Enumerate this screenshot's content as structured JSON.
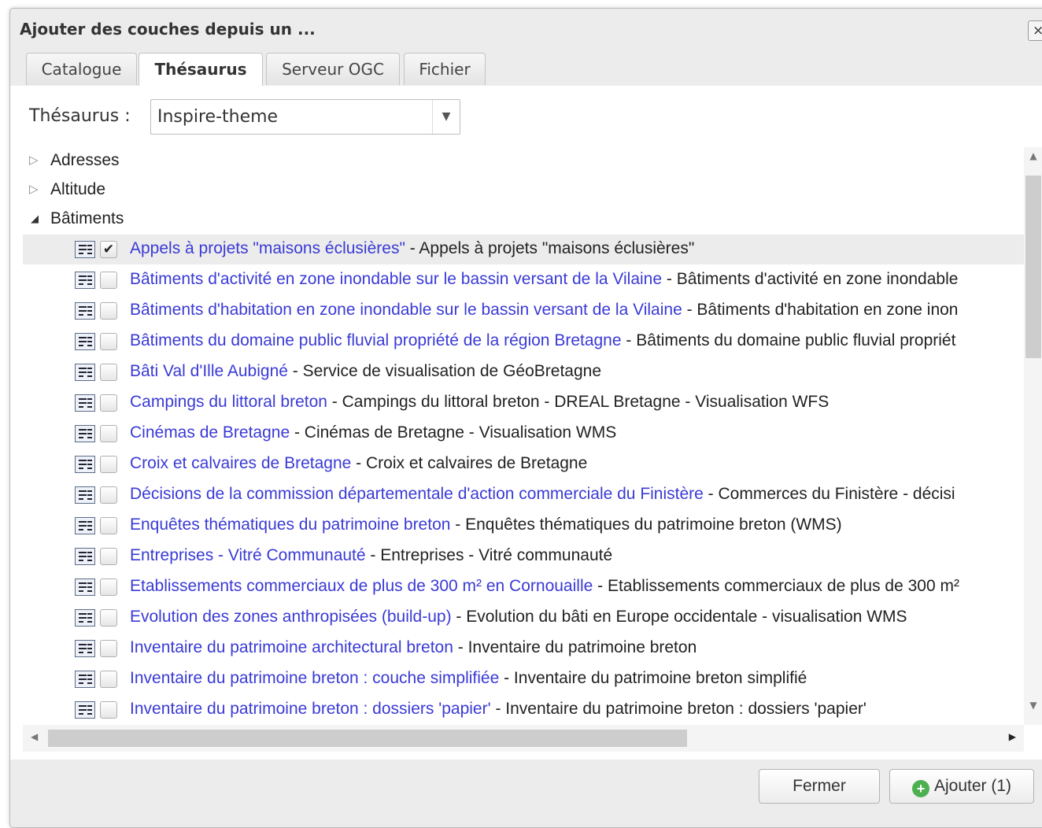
{
  "dialog": {
    "title": "Ajouter des couches depuis un ...",
    "close_label": "×"
  },
  "tabs": [
    {
      "label": "Catalogue"
    },
    {
      "label": "Thésaurus"
    },
    {
      "label": "Serveur OGC"
    },
    {
      "label": "Fichier"
    }
  ],
  "active_tab": "Thésaurus",
  "thesaurus": {
    "label": "Thésaurus :",
    "selected": "Inspire-theme"
  },
  "tree": {
    "nodes": [
      {
        "label": "Adresses",
        "expanded": false
      },
      {
        "label": "Altitude",
        "expanded": false
      },
      {
        "label": "Bâtiments",
        "expanded": true
      }
    ],
    "items": [
      {
        "title": "Appels à projets \"maisons éclusières\"",
        "desc": " - Appels à projets \"maisons éclusières\"",
        "checked": true
      },
      {
        "title": "Bâtiments d'activité en zone inondable sur le bassin versant de la Vilaine",
        "desc": " - Bâtiments d'activité en zone inondable",
        "checked": false
      },
      {
        "title": "Bâtiments d'habitation en zone inondable sur le bassin versant de la Vilaine",
        "desc": " - Bâtiments d'habitation en zone inon",
        "checked": false
      },
      {
        "title": "Bâtiments du domaine public fluvial propriété de la région Bretagne",
        "desc": " - Bâtiments du domaine public fluvial propriét",
        "checked": false
      },
      {
        "title": "Bâti Val d'Ille Aubigné",
        "desc": " - Service de visualisation de GéoBretagne",
        "checked": false
      },
      {
        "title": "Campings du littoral breton",
        "desc": " - Campings du littoral breton - DREAL Bretagne - Visualisation WFS",
        "checked": false
      },
      {
        "title": "Cinémas de Bretagne",
        "desc": " - Cinémas de Bretagne - Visualisation WMS",
        "checked": false
      },
      {
        "title": "Croix et calvaires de Bretagne",
        "desc": " - Croix et calvaires de Bretagne",
        "checked": false
      },
      {
        "title": "Décisions de la commission départementale d'action commerciale du Finistère",
        "desc": " - Commerces du Finistère - décisi",
        "checked": false
      },
      {
        "title": "Enquêtes thématiques du patrimoine breton",
        "desc": " - Enquêtes thématiques du patrimoine breton (WMS)",
        "checked": false
      },
      {
        "title": "Entreprises - Vitré Communauté",
        "desc": " - Entreprises - Vitré communauté",
        "checked": false
      },
      {
        "title": "Etablissements commerciaux de plus de 300 m² en Cornouaille",
        "desc": " - Etablissements commerciaux de plus de 300 m²",
        "checked": false
      },
      {
        "title": "Evolution des zones anthropisées (build-up)",
        "desc": " - Evolution du bâti en Europe occidentale - visualisation WMS",
        "checked": false
      },
      {
        "title": "Inventaire du patrimoine architectural breton",
        "desc": " - Inventaire du patrimoine breton",
        "checked": false
      },
      {
        "title": "Inventaire du patrimoine breton : couche simplifiée",
        "desc": " - Inventaire du patrimoine breton simplifié",
        "checked": false
      },
      {
        "title": "Inventaire du patrimoine breton : dossiers 'papier'",
        "desc": " - Inventaire du patrimoine breton : dossiers 'papier'",
        "checked": false
      }
    ]
  },
  "footer": {
    "close_label": "Fermer",
    "add_label": "Ajouter (1)"
  },
  "colors": {
    "link": "#3a3ad6",
    "selected_row": "#ececec",
    "add_icon": "#4caf50"
  },
  "icons": {
    "collapsed": "triangle-right-icon",
    "expanded": "triangle-down-icon",
    "metadata": "metadata-icon",
    "add": "add-circle-icon"
  }
}
